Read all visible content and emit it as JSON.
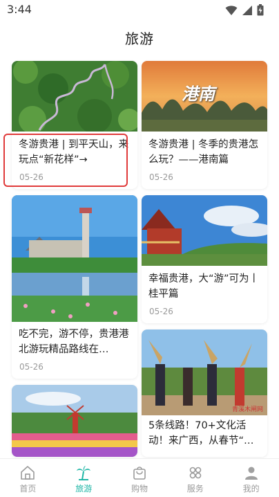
{
  "status_bar": {
    "time": "3:44"
  },
  "header": {
    "title": "旅游"
  },
  "cards": [
    {
      "title": "冬游贵港 | 到平天山，来玩点“新花样”→",
      "date": "05-26"
    },
    {
      "title": "冬游贵港 | 冬季的贵港怎么玩？——港南篇",
      "date": "05-26",
      "image_text": "港南"
    },
    {
      "title": "吃不完，游不停，贵港港北游玩精品路线在…",
      "date": "05-26"
    },
    {
      "title": "幸福贵港，大“游”可为丨桂平篇",
      "date": "05-26"
    },
    {
      "title": "",
      "date": ""
    },
    {
      "title": "5条线路！70+文化活动！来广西，从春节“…",
      "date": "",
      "image_text": "青溪木闸网"
    }
  ],
  "tabbar": {
    "items": [
      {
        "label": "首页",
        "icon": "home-icon"
      },
      {
        "label": "旅游",
        "icon": "palm-tree-icon"
      },
      {
        "label": "购物",
        "icon": "shopping-bag-icon"
      },
      {
        "label": "服务",
        "icon": "service-icon"
      },
      {
        "label": "我的",
        "icon": "user-icon"
      }
    ],
    "active_index": 1
  },
  "colors": {
    "accent": "#1fb6a6",
    "highlight_border": "#e03a3a",
    "date_gray": "#999999"
  }
}
